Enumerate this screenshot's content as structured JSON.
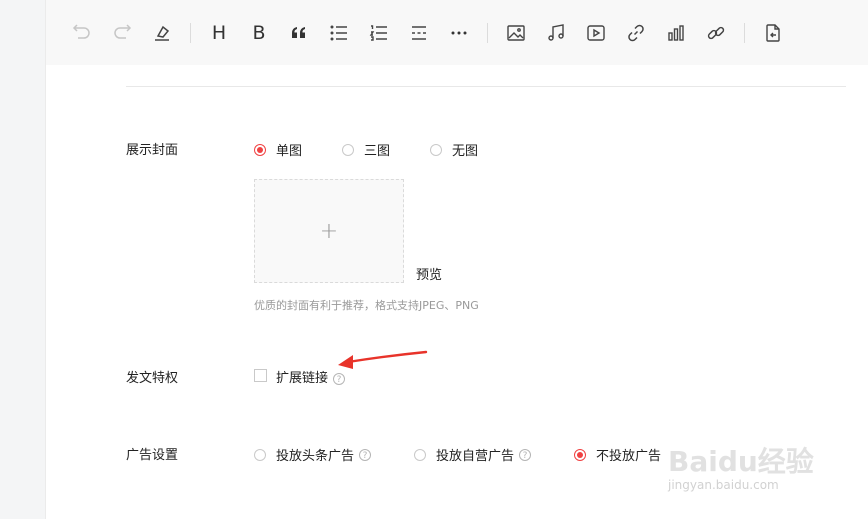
{
  "toolbar": {
    "heading_label": "H",
    "bold_label": "B"
  },
  "cover": {
    "label": "展示封面",
    "options": [
      "单图",
      "三图",
      "无图"
    ],
    "selected": "单图",
    "upload_plus": "+",
    "preview": "预览",
    "hint": "优质的封面有利于推荐，格式支持JPEG、PNG"
  },
  "privilege": {
    "label": "发文特权",
    "checkbox_label": "扩展链接",
    "help": "?"
  },
  "ads": {
    "label": "广告设置",
    "options": [
      "投放头条广告",
      "投放自营广告",
      "不投放广告"
    ],
    "selected": "不投放广告",
    "help": "?"
  },
  "watermark": {
    "text": "Baidu经验",
    "sub": "jingyan.baidu.com"
  },
  "colors": {
    "accent": "#f04142",
    "arrow": "#e8332a"
  }
}
